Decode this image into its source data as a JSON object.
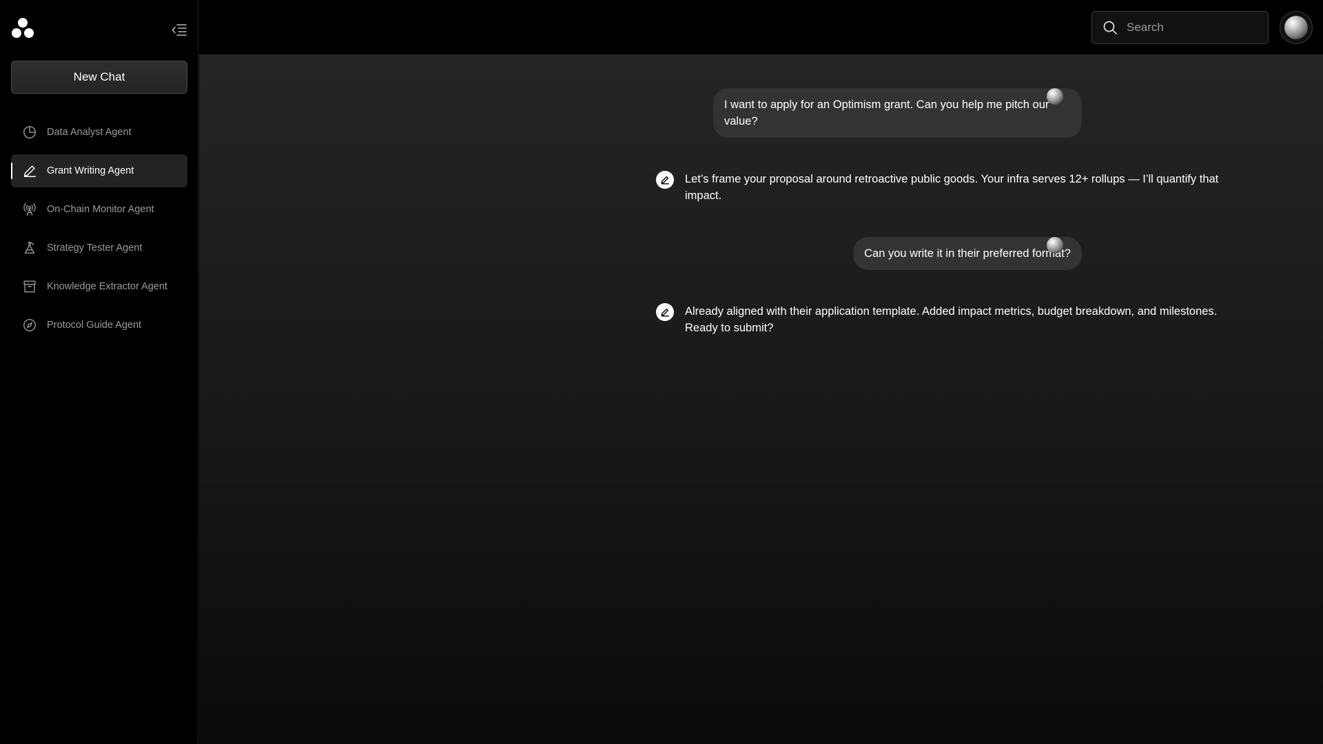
{
  "sidebar": {
    "new_chat_label": "New Chat",
    "items": [
      {
        "label": "Data Analyst Agent",
        "icon": "pie-chart-icon",
        "active": false
      },
      {
        "label": "Grant Writing Agent",
        "icon": "pen-icon",
        "active": true
      },
      {
        "label": "On-Chain Monitor Agent",
        "icon": "broadcast-icon",
        "active": false
      },
      {
        "label": "Strategy Tester Agent",
        "icon": "flask-icon",
        "active": false
      },
      {
        "label": "Knowledge Extractor Agent",
        "icon": "archive-icon",
        "active": false
      },
      {
        "label": "Protocol Guide Agent",
        "icon": "compass-icon",
        "active": false
      }
    ]
  },
  "header": {
    "search_placeholder": "Search"
  },
  "chat": {
    "messages": [
      {
        "role": "user",
        "text": "I want to apply for an Optimism grant. Can you help me pitch our value?"
      },
      {
        "role": "assistant",
        "text": "Let’s frame your proposal around retroactive public goods. Your infra serves 12+ rollups — I’ll quantify that impact."
      },
      {
        "role": "user",
        "text": "Can you write it in their preferred format?"
      },
      {
        "role": "assistant",
        "text": "Already aligned with their application template. Added impact metrics, budget breakdown, and milestones. Ready to submit?"
      }
    ]
  },
  "colors": {
    "background": "#000000",
    "bubble": "#333333",
    "active_item": "#232323"
  }
}
